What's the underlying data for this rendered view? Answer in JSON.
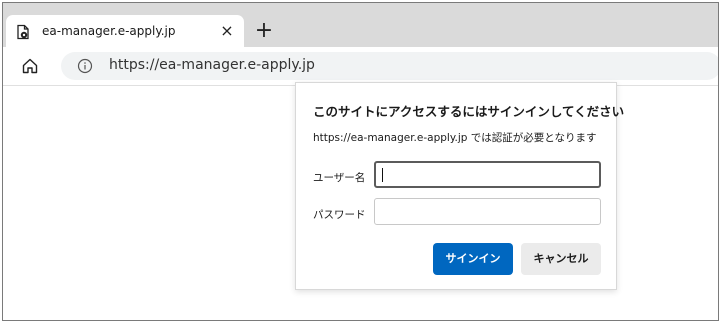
{
  "browser": {
    "tab": {
      "title": "ea-manager.e-apply.jp",
      "favicon_icon": "page-gear-icon",
      "close_label": "×"
    },
    "new_tab_label": "+",
    "toolbar": {
      "home_icon": "home-icon",
      "info_icon": "info-icon",
      "url": "https://ea-manager.e-apply.jp"
    }
  },
  "auth_dialog": {
    "title": "このサイトにアクセスするにはサインインしてください",
    "description": "https://ea-manager.e-apply.jp では認証が必要となります",
    "username": {
      "label": "ユーザー名",
      "value": ""
    },
    "password": {
      "label": "パスワード",
      "value": ""
    },
    "sign_in_label": "サインイン",
    "cancel_label": "キャンセル",
    "colors": {
      "primary": "#0067c0",
      "secondary": "#ebebeb"
    }
  }
}
